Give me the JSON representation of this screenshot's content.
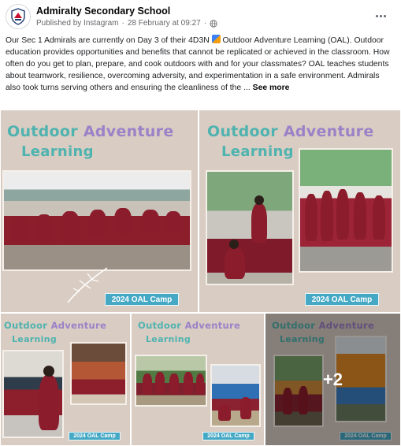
{
  "post": {
    "page_name": "Admiralty Secondary School",
    "published_by": "Published by Instagram",
    "separator": "·",
    "date": "28 February at 09:27",
    "more_icon": "more-horizontal-icon",
    "caption_before_emoji": "Our Sec 1 Admirals are currently on Day 3 of their 4D3N",
    "caption_after_emoji": " Outdoor Adventure Learning (OAL). Outdoor education provides opportunities and benefits that cannot be replicated or achieved in the classroom. How often do you get to plan, prepare, and cook outdoors with and for your classmates? OAL teaches students about teamwork, resilience, overcoming adversity, and experimentation in a safe environment. Admirals also took turns serving others and ensuring the cleanliness of the ...",
    "see_more": "See more"
  },
  "gallery": {
    "tiles": [
      {
        "title_line1": "Outdoor Adventure",
        "title_line2": "Learning",
        "badge": "2024 OAL Camp"
      },
      {
        "title_line1": "Outdoor Adventure",
        "title_line2": "Learning",
        "badge": "2024 OAL Camp"
      },
      {
        "title_line1": "Outdoor Adventure",
        "title_line2": "Learning",
        "badge": "2024 OAL Camp"
      },
      {
        "title_line1": "Outdoor Adventure",
        "title_line2": "Learning",
        "badge": "2024 OAL Camp"
      },
      {
        "title_line1": "Outdoor Adventure",
        "title_line2": "Learning",
        "badge": "2024 OAL Camp"
      }
    ],
    "more_count": "+2"
  },
  "colors": {
    "tile_bg": "#d9ccc2",
    "title_teal": "#4fb3b0",
    "title_purple": "#9b82c8",
    "badge": "#45a8c4"
  }
}
